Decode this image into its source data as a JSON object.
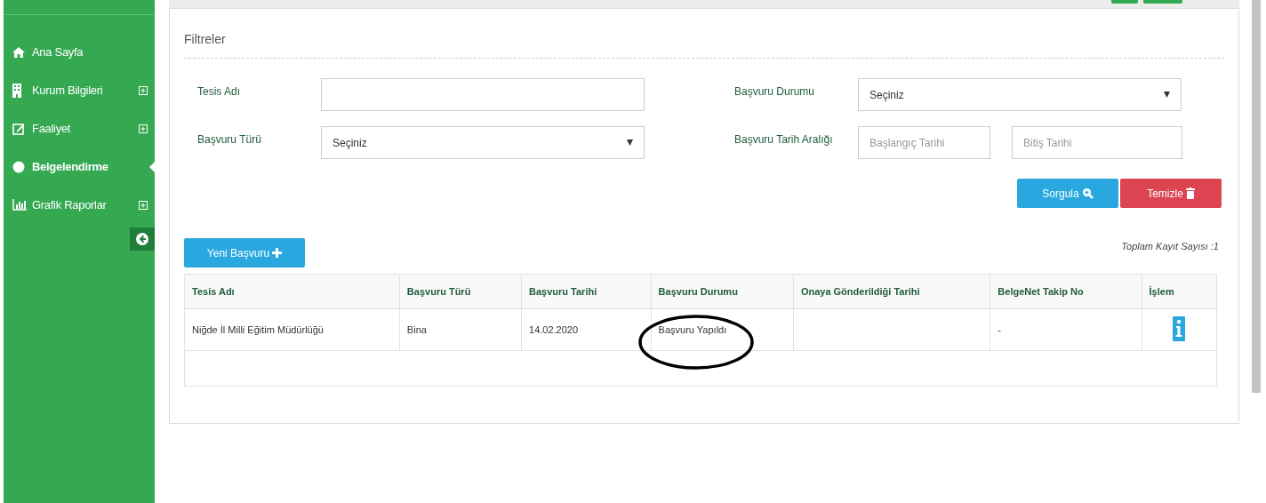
{
  "sidebar": {
    "items": [
      {
        "label": "Ana Sayfa",
        "expandable": false,
        "selected": false
      },
      {
        "label": "Kurum Bilgileri",
        "expandable": true,
        "selected": false
      },
      {
        "label": "Faaliyet",
        "expandable": true,
        "selected": false
      },
      {
        "label": "Belgelendirme",
        "expandable": false,
        "selected": true
      },
      {
        "label": "Grafik Raporlar",
        "expandable": true,
        "selected": false
      }
    ]
  },
  "filters": {
    "title": "Filtreler",
    "fields": [
      {
        "kind": "text",
        "label": "Tesis Adı"
      },
      {
        "kind": "select",
        "label": "Başvuru Durumu",
        "value": "Seçiniz"
      },
      {
        "kind": "select",
        "label": "Başvuru Türü",
        "value": "Seçiniz"
      },
      {
        "kind": "daterange",
        "label": "Başvuru Tarih Aralığı",
        "start_placeholder": "Başlangıç Tarihi",
        "end_placeholder": "Bitiş Tarihi"
      }
    ],
    "buttons": [
      {
        "kind": "query",
        "label": "Sorgula"
      },
      {
        "kind": "clear",
        "label": "Temizle"
      }
    ]
  },
  "new_button": {
    "label": "Yeni Başvuru"
  },
  "total": "Toplam Kayıt Sayısı :1",
  "table": {
    "columns": [
      "Tesis Adı",
      "Başvuru Türü",
      "Başvuru Tarihi",
      "Başvuru Durumu",
      "Onaya Gönderildiği Tarihi",
      "BelgeNet Takip No",
      "İşlem"
    ],
    "rows": [
      {
        "cells": [
          "Niğde İl Milli Eğitim Müdürlüğü",
          "Bina",
          "14.02.2020",
          "Başvuru Yapıldı",
          "",
          "-"
        ],
        "annotated": true
      }
    ]
  }
}
